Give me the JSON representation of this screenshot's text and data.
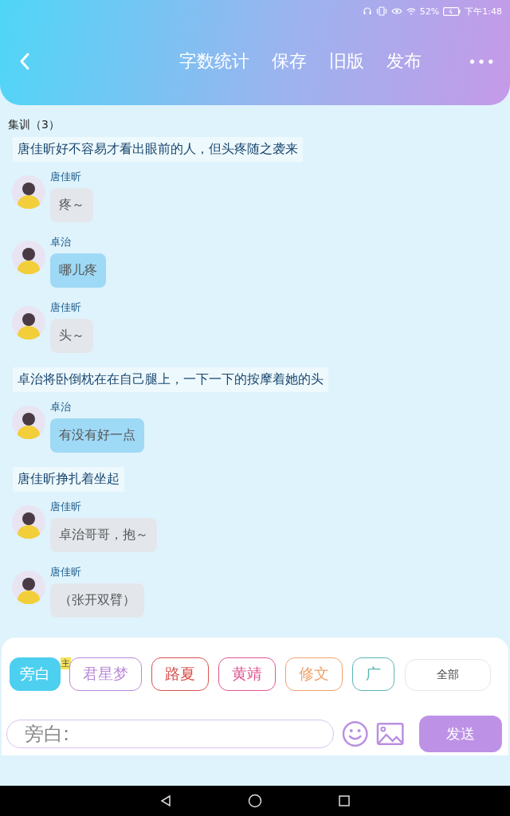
{
  "status_bar": {
    "battery": "52%",
    "time": "下午1:48"
  },
  "header": {
    "actions": [
      "字数统计",
      "保存",
      "旧版",
      "发布"
    ],
    "more": "•••"
  },
  "chat_title": "集训（3）",
  "messages": [
    {
      "kind": "narration",
      "text": "唐佳昕好不容易才看出眼前的人，但头疼随之袭来"
    },
    {
      "kind": "speech",
      "speaker": "唐佳昕",
      "text": "疼～",
      "color": "#e3e7ec"
    },
    {
      "kind": "speech",
      "speaker": "卓治",
      "text": "哪儿疼",
      "color": "#9ed9f5"
    },
    {
      "kind": "speech",
      "speaker": "唐佳昕",
      "text": "头～",
      "color": "#e3e7ec"
    },
    {
      "kind": "narration",
      "text": "卓治将卧倒枕在在自己腿上，一下一下的按摩着她的头"
    },
    {
      "kind": "speech",
      "speaker": "卓治",
      "text": "有没有好一点",
      "color": "#9ed9f5"
    },
    {
      "kind": "narration",
      "text": "唐佳昕挣扎着坐起"
    },
    {
      "kind": "speech",
      "speaker": "唐佳昕",
      "text": "卓治哥哥，抱～",
      "color": "#e3e7ec"
    },
    {
      "kind": "speech",
      "speaker": "唐佳昕",
      "text": "（张开双臂）",
      "color": "#e3e7ec"
    }
  ],
  "roles": [
    {
      "label": "旁白",
      "color": "#4dcff0",
      "selected": true
    },
    {
      "label": "君星梦",
      "color": "#b98ad8",
      "selected": false,
      "badge": "主"
    },
    {
      "label": "路夏",
      "color": "#d9534f",
      "selected": false
    },
    {
      "label": "黄靖",
      "color": "#e0548f",
      "selected": false
    },
    {
      "label": "修文",
      "color": "#f0a26e",
      "selected": false
    },
    {
      "label": "广",
      "color": "#5bb5b5",
      "selected": false
    }
  ],
  "all_button": "全部",
  "composer": {
    "placeholder": "旁白:",
    "send": "发送"
  }
}
